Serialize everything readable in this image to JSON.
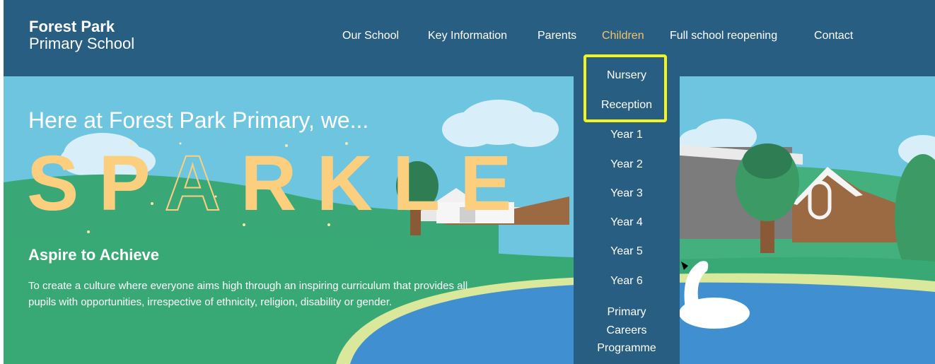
{
  "header": {
    "logo_line1": "Forest Park",
    "logo_line2": "Primary School",
    "nav": [
      {
        "label": "Our School"
      },
      {
        "label": "Key Information"
      },
      {
        "label": "Parents"
      },
      {
        "label": "Children",
        "active": true
      },
      {
        "label": "Full school reopening"
      },
      {
        "label": "Contact"
      }
    ]
  },
  "dropdown": {
    "items": [
      {
        "label": "Nursery"
      },
      {
        "label": "Reception"
      },
      {
        "label": "Year 1"
      },
      {
        "label": "Year 2"
      },
      {
        "label": "Year 3"
      },
      {
        "label": "Year 4"
      },
      {
        "label": "Year 5"
      },
      {
        "label": "Year 6"
      },
      {
        "label": "Primary Careers Programme"
      }
    ]
  },
  "hero": {
    "heading": "Here at Forest Park Primary, we...",
    "sparkle_word": "SPARKLE",
    "aspire_title": "Aspire to Achieve",
    "aspire_text": "To create a culture where everyone aims high through an inspiring curriculum that provides all pupils with opportunities, irrespective of ethnicity, religion, disability or gender."
  },
  "colors": {
    "header_bg": "#285e82",
    "active_nav": "#f2c46a",
    "sky": "#6ec5e0",
    "grass": "#38a874",
    "water": "#3f8fd1",
    "sparkle_yellow": "#fccf7e",
    "highlight": "#f3f31e"
  }
}
